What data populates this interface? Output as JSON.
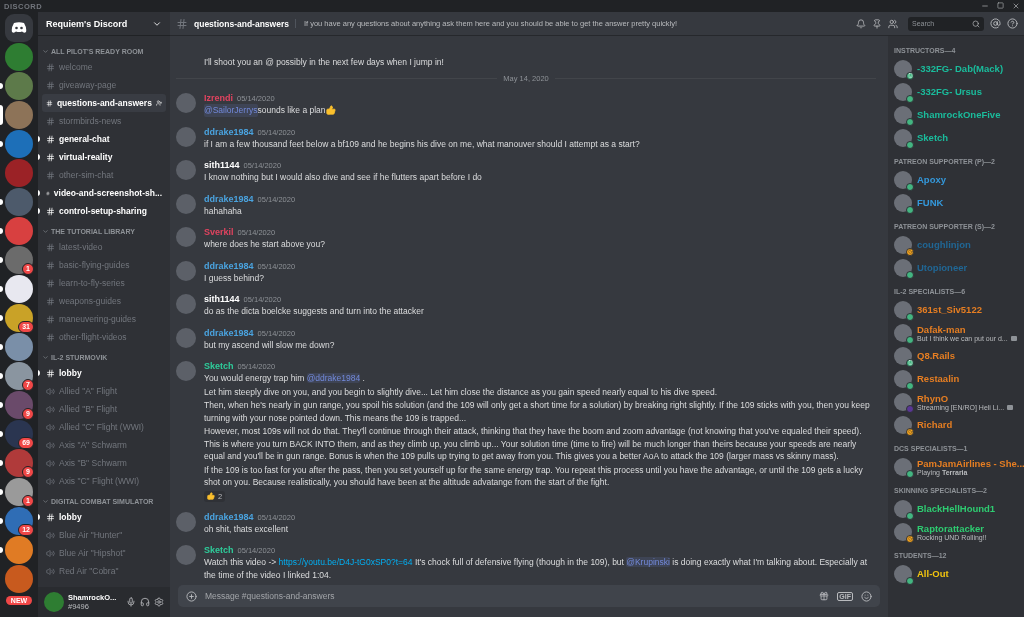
{
  "app_title": "DISCORD",
  "servers": [
    {
      "kind": "home",
      "color": "#36393f",
      "selected": false,
      "unread": false
    },
    {
      "kind": "server",
      "color": "#2e7d32",
      "selected": false,
      "unread": false
    },
    {
      "kind": "server",
      "color": "#5d7a4a",
      "selected": false,
      "unread": true
    },
    {
      "kind": "server",
      "color": "#8d7358",
      "selected": true,
      "unread": false
    },
    {
      "kind": "server",
      "color": "#1d6fb8",
      "selected": false,
      "unread": true
    },
    {
      "kind": "server",
      "color": "#9b2226",
      "selected": false,
      "unread": false
    },
    {
      "kind": "server",
      "color": "#4d5a6b",
      "selected": false,
      "unread": true
    },
    {
      "kind": "server",
      "color": "#d84040",
      "selected": false,
      "unread": true
    },
    {
      "kind": "server",
      "color": "#6b6b6b",
      "selected": false,
      "unread": true,
      "badge": "1"
    },
    {
      "kind": "server",
      "color": "#e8e8f0",
      "selected": false,
      "unread": true
    },
    {
      "kind": "server",
      "color": "#c9a227",
      "selected": false,
      "unread": true,
      "badge": "31"
    },
    {
      "kind": "server",
      "color": "#7a8fa8",
      "selected": false,
      "unread": true
    },
    {
      "kind": "server",
      "color": "#8a95a0",
      "selected": false,
      "unread": true,
      "badge": "7"
    },
    {
      "kind": "server",
      "color": "#6a4a6a",
      "selected": false,
      "unread": true,
      "badge": "9"
    },
    {
      "kind": "server",
      "color": "#2a3550",
      "selected": false,
      "unread": true,
      "badge": "69"
    },
    {
      "kind": "server",
      "color": "#b03a3a",
      "selected": false,
      "unread": true,
      "badge": "9"
    },
    {
      "kind": "server",
      "color": "#9a9a9a",
      "selected": false,
      "unread": true,
      "badge": "1"
    },
    {
      "kind": "server",
      "color": "#2f6db5",
      "selected": false,
      "unread": true,
      "badge": "12"
    },
    {
      "kind": "server",
      "color": "#e07b24",
      "selected": false,
      "unread": true
    },
    {
      "kind": "server",
      "color": "#c85a1e",
      "selected": false,
      "unread": false
    }
  ],
  "new_badge": "NEW",
  "server_name": "Requiem's Discord",
  "categories": [
    {
      "name": "ALL PILOT'S READY ROOM",
      "channels": [
        {
          "kind": "text",
          "name": "welcome",
          "unread": false,
          "selected": false
        },
        {
          "kind": "text",
          "name": "giveaway-page",
          "unread": false,
          "selected": false
        },
        {
          "kind": "text",
          "name": "questions-and-answers",
          "unread": false,
          "selected": true
        },
        {
          "kind": "text",
          "name": "stormbirds-news",
          "unread": false,
          "selected": false
        },
        {
          "kind": "text",
          "name": "general-chat",
          "unread": true,
          "selected": false
        },
        {
          "kind": "text",
          "name": "virtual-reality",
          "unread": true,
          "selected": false
        },
        {
          "kind": "text",
          "name": "other-sim-chat",
          "unread": false,
          "selected": false
        },
        {
          "kind": "text",
          "name": "video-and-screenshot-sh...",
          "unread": true,
          "selected": false
        },
        {
          "kind": "text",
          "name": "control-setup-sharing",
          "unread": true,
          "selected": false
        }
      ]
    },
    {
      "name": "THE TUTORIAL LIBRARY",
      "channels": [
        {
          "kind": "text",
          "name": "latest-video",
          "unread": false,
          "selected": false
        },
        {
          "kind": "text",
          "name": "basic-flying-guides",
          "unread": false,
          "selected": false
        },
        {
          "kind": "text",
          "name": "learn-to-fly-series",
          "unread": false,
          "selected": false
        },
        {
          "kind": "text",
          "name": "weapons-guides",
          "unread": false,
          "selected": false
        },
        {
          "kind": "text",
          "name": "maneuvering-guides",
          "unread": false,
          "selected": false
        },
        {
          "kind": "text",
          "name": "other-flight-videos",
          "unread": false,
          "selected": false
        }
      ]
    },
    {
      "name": "IL-2 STURMOVIK",
      "channels": [
        {
          "kind": "text",
          "name": "lobby",
          "unread": true,
          "selected": false
        },
        {
          "kind": "voice",
          "name": "Allied \"A\" Flight",
          "unread": false,
          "selected": false
        },
        {
          "kind": "voice",
          "name": "Allied \"B\" Flight",
          "unread": false,
          "selected": false
        },
        {
          "kind": "voice",
          "name": "Allied \"C\" Flight (WWI)",
          "unread": false,
          "selected": false
        },
        {
          "kind": "voice",
          "name": "Axis \"A\" Schwarm",
          "unread": false,
          "selected": false
        },
        {
          "kind": "voice",
          "name": "Axis \"B\" Schwarm",
          "unread": false,
          "selected": false
        },
        {
          "kind": "voice",
          "name": "Axis \"C\" Flight (WWI)",
          "unread": false,
          "selected": false
        }
      ]
    },
    {
      "name": "DIGITAL COMBAT SIMULATOR",
      "channels": [
        {
          "kind": "text",
          "name": "lobby",
          "unread": true,
          "selected": false
        },
        {
          "kind": "voice",
          "name": "Blue Air \"Hunter\"",
          "unread": false,
          "selected": false
        },
        {
          "kind": "voice",
          "name": "Blue Air \"Hipshot\"",
          "unread": false,
          "selected": false
        },
        {
          "kind": "voice",
          "name": "Red Air \"Cobra\"",
          "unread": false,
          "selected": false
        }
      ]
    }
  ],
  "user": {
    "name": "ShamrockO...",
    "tag": "#9496"
  },
  "header": {
    "channel": "questions-and-answers",
    "topic": "If you have any questions about anything ask them here and you should be able to get the answer pretty quickly!",
    "search_placeholder": "Search"
  },
  "messages": [
    {
      "kind": "continuation",
      "paragraphs": [
        [
          {
            "kind": "text",
            "text": "I'll shoot you an @ possibly in the next few days when I jump in!"
          }
        ]
      ]
    },
    {
      "kind": "divider",
      "text": "May 14, 2020"
    },
    {
      "kind": "message",
      "author": "Izrendi",
      "color": "#e0435f",
      "time": "05/14/2020",
      "paragraphs": [
        [
          {
            "kind": "mention",
            "text": "@SailorJerrys"
          },
          {
            "kind": "text",
            "text": " sounds like a plan "
          },
          {
            "kind": "emoji"
          }
        ]
      ]
    },
    {
      "kind": "message",
      "author": "ddrake1984",
      "color": "#4aa3df",
      "time": "05/14/2020",
      "paragraphs": [
        [
          {
            "kind": "text",
            "text": "if I am a few thousand feet below a bf109 and he begins his dive on me, what manouver should I attempt as a start?"
          }
        ]
      ]
    },
    {
      "kind": "message",
      "author": "sith1144",
      "color": "#ffffff",
      "time": "05/14/2020",
      "paragraphs": [
        [
          {
            "kind": "text",
            "text": "I know nothing but I would also dive and see if he flutters apart before I do"
          }
        ]
      ]
    },
    {
      "kind": "message",
      "author": "ddrake1984",
      "color": "#4aa3df",
      "time": "05/14/2020",
      "paragraphs": [
        [
          {
            "kind": "text",
            "text": "hahahaha"
          }
        ]
      ]
    },
    {
      "kind": "message",
      "author": "Sverkil",
      "color": "#e0435f",
      "time": "05/14/2020",
      "paragraphs": [
        [
          {
            "kind": "text",
            "text": "where does he start above you?"
          }
        ]
      ]
    },
    {
      "kind": "message",
      "author": "ddrake1984",
      "color": "#4aa3df",
      "time": "05/14/2020",
      "paragraphs": [
        [
          {
            "kind": "text",
            "text": "I guess behind?"
          }
        ]
      ]
    },
    {
      "kind": "message",
      "author": "sith1144",
      "color": "#ffffff",
      "time": "05/14/2020",
      "paragraphs": [
        [
          {
            "kind": "text",
            "text": "do as the dicta boelcke suggests and turn into the attacker"
          }
        ]
      ]
    },
    {
      "kind": "message",
      "author": "ddrake1984",
      "color": "#4aa3df",
      "time": "05/14/2020",
      "paragraphs": [
        [
          {
            "kind": "text",
            "text": "but my ascend will slow me down?"
          }
        ]
      ]
    },
    {
      "kind": "message",
      "author": "Sketch",
      "color": "#2ecc9a",
      "time": "05/14/2020",
      "reaction": {
        "count": "2"
      },
      "paragraphs": [
        [
          {
            "kind": "text",
            "text": "You would energy trap him "
          },
          {
            "kind": "mention",
            "text": "@ddrake1984"
          },
          {
            "kind": "text",
            "text": " ."
          }
        ],
        [
          {
            "kind": "text",
            "text": "Let him steeply dive on you, and you begin to slightly dive... Let him close the distance as you gain speed nearly equal to his dive speed."
          }
        ],
        [
          {
            "kind": "text",
            "text": "Then, when he's nearly in gun range, you spoil his solution (and the 109 will only get a short time for a solution) by breaking right slightly. If the 109 sticks with you, then you keep turning with your nose pointed down. This means the 109 is trapped..."
          }
        ],
        [
          {
            "kind": "text",
            "text": "However, most 109s will not do that. They'll continue through their attack, thinking that they have the boom and zoom advantage (not knowing that you've equaled their speed). This is where you turn BACK INTO them, and as they climb up, you climb up... Your solution time (time to fire) will be much longer than theirs because your speeds are nearly equal and you'll be in gun range. Bonus is when the 109 pulls up trying to get away from you. This gives you a better AoA to attack the 109 (larger mass vs skinny mass)."
          }
        ],
        [
          {
            "kind": "text",
            "text": "If the 109 is too fast for you after the pass, then you set yourself up for the same energy trap. You repeat this process until you have the advantage, or until the 109 gets a lucky shot on you. Because realistically, you should have been at the altitude advatange from the start of the fight."
          }
        ]
      ]
    },
    {
      "kind": "message",
      "author": "ddrake1984",
      "color": "#4aa3df",
      "time": "05/14/2020",
      "paragraphs": [
        [
          {
            "kind": "text",
            "text": "oh shit, thats excellent"
          }
        ]
      ]
    },
    {
      "kind": "message",
      "author": "Sketch",
      "color": "#2ecc9a",
      "time": "05/14/2020",
      "paragraphs": [
        [
          {
            "kind": "text",
            "text": "Watch this video -> "
          },
          {
            "kind": "link",
            "text": "https://youtu.be/D4J-tG0xSP0?t=64"
          },
          {
            "kind": "text",
            "text": " It's chock full of defensive flying (though in the 109), but "
          },
          {
            "kind": "mention",
            "text": "@Krupinski"
          },
          {
            "kind": "text",
            "text": " is doing exactly what I'm talking about. Especially at the time of the video I linked 1:04."
          }
        ]
      ]
    }
  ],
  "composer": {
    "placeholder": "Message #questions-and-answers",
    "gif_label": "GIF"
  },
  "member_groups": [
    {
      "title": "INSTRUCTORS—4",
      "members": [
        {
          "name": "-332FG- Dab(Mack)",
          "color": "#1abc9c",
          "kind": "mobile"
        },
        {
          "name": "-332FG- Ursus",
          "color": "#1abc9c",
          "kind": "online"
        },
        {
          "name": "ShamrockOneFive",
          "color": "#1abc9c",
          "kind": "online"
        },
        {
          "name": "Sketch",
          "color": "#1abc9c",
          "kind": "online"
        }
      ]
    },
    {
      "title": "PATREON SUPPORTER (P)—2",
      "members": [
        {
          "name": "Apoxy",
          "color": "#3498db",
          "kind": "online"
        },
        {
          "name": "FUNK",
          "color": "#3498db",
          "kind": "online"
        }
      ]
    },
    {
      "title": "PATREON SUPPORTER (S)—2",
      "members": [
        {
          "name": "coughlinjon",
          "color": "#206694",
          "kind": "idle"
        },
        {
          "name": "Utopioneer",
          "color": "#206694",
          "kind": "online"
        }
      ]
    },
    {
      "title": "IL-2 SPECIALISTS—6",
      "members": [
        {
          "name": "361st_Siv5122",
          "color": "#e67e22",
          "kind": "online"
        },
        {
          "name": "Dafak-man",
          "color": "#e67e22",
          "kind": "online",
          "activity": "But I think we can put our d...",
          "activity_icon": true
        },
        {
          "name": "Q8.Rails",
          "color": "#e67e22",
          "kind": "mobile"
        },
        {
          "name": "Restaalin",
          "color": "#e67e22",
          "kind": "online"
        },
        {
          "name": "RhynO",
          "color": "#e67e22",
          "kind": "streaming",
          "activity": "Streaming [EN/RO] Heli Li...",
          "activity_icon": true
        },
        {
          "name": "Richard",
          "color": "#e67e22",
          "kind": "idle"
        }
      ]
    },
    {
      "title": "DCS SPECIALISTS—1",
      "members": [
        {
          "name": "PamJamAirlines - She...",
          "color": "#e67e22",
          "kind": "online",
          "activity": "Playing **Terraria**"
        }
      ]
    },
    {
      "title": "SKINNING SPECIALISTS—2",
      "members": [
        {
          "name": "BlackHellHound1",
          "color": "#2ecc71",
          "kind": "online"
        },
        {
          "name": "Raptorattacker",
          "color": "#2ecc71",
          "kind": "idle",
          "activity": "Rocking UND Rolling!!"
        }
      ]
    },
    {
      "title": "STUDENTS—12",
      "members": [
        {
          "name": "All-Out",
          "color": "#f1c40f",
          "kind": "online"
        }
      ]
    }
  ]
}
